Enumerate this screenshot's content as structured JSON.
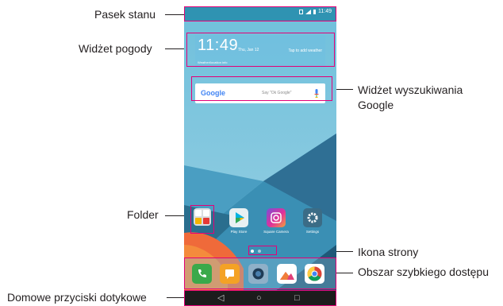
{
  "annotations": {
    "status_bar": "Pasek stanu",
    "weather_widget": "Widżet pogody",
    "google_widget_line1": "Widżet wyszukiwania",
    "google_widget_line2": "Google",
    "folder": "Folder",
    "page_icon": "Ikona strony",
    "quick_access": "Obszar szybkiego dostępu",
    "home_buttons": "Domowe przyciski dotykowe"
  },
  "status": {
    "time": "11:49",
    "icons": [
      "nfc-icon",
      "signal-icon",
      "battery-icon"
    ]
  },
  "weather": {
    "time": "11:49",
    "date": "Thu, Jan 12",
    "tap_text": "Tap to add weather",
    "location": "Weather/location info"
  },
  "google_search": {
    "logo": "Google",
    "hint": "Say \"Ok Google\"",
    "icon": "mic-icon"
  },
  "apps": [
    {
      "label": "",
      "icon": "folder-icon"
    },
    {
      "label": "Play Store",
      "icon": "play-store-icon"
    },
    {
      "label": "Square Camera",
      "icon": "square-camera-icon"
    },
    {
      "label": "Settings",
      "icon": "settings-gear-icon"
    }
  ],
  "dock": [
    "phone-icon",
    "messages-icon",
    "camera-icon",
    "gallery-icon",
    "chrome-icon"
  ],
  "navbar": {
    "back": "◁",
    "home": "○",
    "recent": "□"
  },
  "colors": {
    "accent": "#e40078",
    "statusbar": "#2f93b2",
    "sky": "#7dc1d8"
  }
}
